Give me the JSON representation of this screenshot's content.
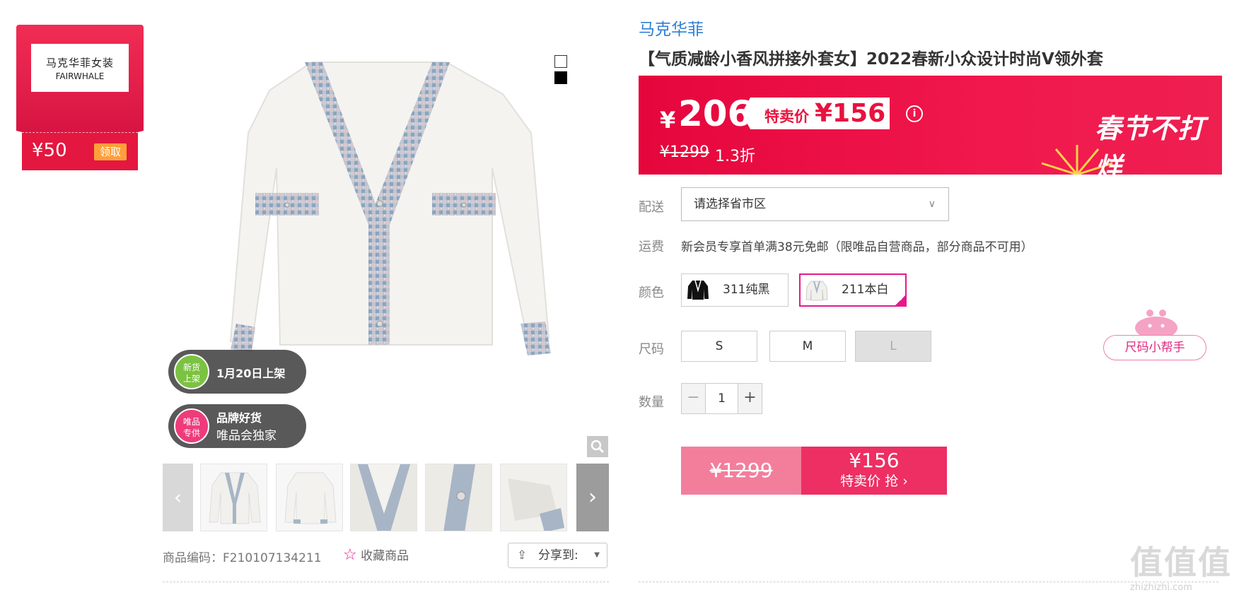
{
  "coupon": {
    "brand_zh": "马克华菲女装",
    "brand_en": "FAIRWHALE",
    "amount": "¥50",
    "claim_label": "领取"
  },
  "badges": {
    "new": {
      "circle": "新货上架",
      "text": "1月20日上架"
    },
    "exclusive": {
      "circle": "唯品专供",
      "title": "品牌好货",
      "subtitle": "唯品会独家"
    }
  },
  "product": {
    "brand": "马克华菲",
    "title": "【气质减龄小香风拼接外套女】2022春新小众设计时尚V领外套",
    "sku_label": "商品编码：",
    "sku": "F210107134211",
    "favorite_label": "收藏商品",
    "share_label": "分享到:"
  },
  "price": {
    "currency": "¥",
    "main": "206",
    "special_label": "特卖价",
    "special": "¥156",
    "original": "¥1299",
    "discount": "1.3折",
    "slogan": "春节不打烊"
  },
  "options": {
    "shipping_label": "配送",
    "shipping_placeholder": "请选择省市区",
    "fee_label": "运费",
    "fee_text": "新会员专享首单满38元免邮（限唯品自营商品，部分商品不可用）",
    "color_label": "颜色",
    "colors": [
      "311纯黑",
      "211本白"
    ],
    "selected_color": "211本白",
    "size_label": "尺码",
    "sizes": [
      "S",
      "M",
      "L"
    ],
    "disabled_size": "L",
    "qty_label": "数量",
    "qty": "1"
  },
  "buy": {
    "original": "¥1299",
    "price": "¥156",
    "action": "特卖价 抢 ›"
  },
  "helper": {
    "label": "尺码小帮手"
  },
  "watermark": {
    "big": "值值值",
    "small": "zhizhizhi.com"
  },
  "colors": {
    "accent": "#e8123f",
    "pink": "#e5198a",
    "brand_blue": "#2f7fd4"
  }
}
